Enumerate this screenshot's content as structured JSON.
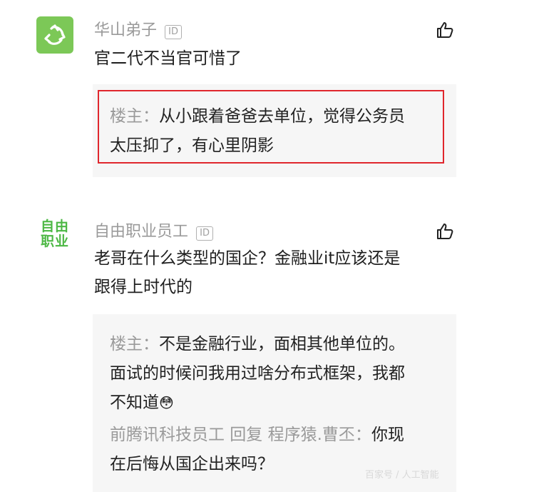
{
  "comments": [
    {
      "username": "华山弟子",
      "id_badge": "ID",
      "avatar_icon": "recycle-icon",
      "text": "官二代不当官可惜了",
      "reply": {
        "author": "楼主：",
        "line1": "从小跟着爸爸去单位，觉得公务员",
        "line2": "太压抑了，有心里阴影"
      }
    },
    {
      "username": "自由职业员工",
      "id_badge": "ID",
      "avatar_text_line1": "自由",
      "avatar_text_line2": "职业",
      "text_line1": "老哥在什么类型的国企？金融业it应该还是",
      "text_line2": "跟得上时代的",
      "reply": {
        "author": "楼主：",
        "line1": "不是金融行业，面相其他单位的。",
        "line2": "面试的时候问我用过啥分布式框架，我都",
        "line3": "不知道",
        "emoji": "😳",
        "sub_author": "前腾讯科技员工 回复 程序猿.曹丕：",
        "sub_line1": "你现",
        "sub_line2": "在后悔从国企出来吗？"
      }
    }
  ],
  "watermark": "百家号 / 人工智能",
  "colors": {
    "accent_green": "#7cc857",
    "highlight_red": "#e0262d"
  }
}
